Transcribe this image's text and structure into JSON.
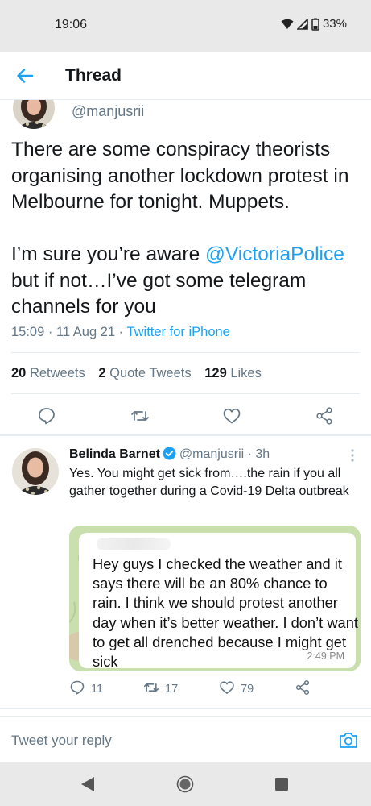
{
  "status_bar": {
    "time": "19:06",
    "battery": "33%"
  },
  "header": {
    "title": "Thread",
    "back_icon": "arrow-left-icon"
  },
  "main_tweet": {
    "handle": "@manjusrii",
    "text_part1": "There are some conspiracy theorists organising another lockdown protest in Melbourne for tonight. Muppets.\n\nI’m sure you’re aware ",
    "mention": "@VictoriaPolice",
    "text_part2": " but if not…I’ve got some telegram channels for you",
    "time": "15:09",
    "date": "11 Aug 21",
    "source": "Twitter for iPhone",
    "retweets_count": "20",
    "retweets_label": "Retweets",
    "quotes_count": "2",
    "quotes_label": "Quote Tweets",
    "likes_count": "129",
    "likes_label": "Likes"
  },
  "reply": {
    "name": "Belinda Barnet",
    "handle": "@manjusrii",
    "age": "3h",
    "text": "Yes. You might get sick from….the rain if you all gather together during a Covid-19 Delta outbreak",
    "image": {
      "message": "Hey guys I checked the weather and it says there will be an 80% chance to rain. I think we should protest another day when it’s better weather. I don’t want to get all drenched because I might get sick",
      "time": "2:49 PM"
    },
    "reply_count": "11",
    "retweet_count": "17",
    "like_count": "79"
  },
  "composer": {
    "placeholder": "Tweet your reply"
  },
  "colors": {
    "accent": "#1da1f2",
    "secondary_text": "#657786",
    "primary_text": "#14171a"
  }
}
